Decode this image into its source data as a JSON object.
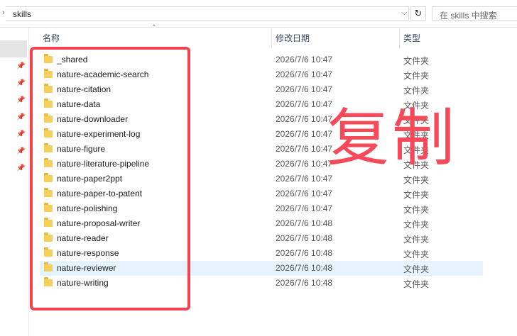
{
  "address": {
    "path": "skills",
    "dropdown_icon": "chevron-down-icon",
    "refresh_icon": "refresh-icon"
  },
  "search": {
    "placeholder": "在 skills 中搜索"
  },
  "columns": {
    "name": "名称",
    "date": "修改日期",
    "type": "类型"
  },
  "files": [
    {
      "name": "_shared",
      "date": "2026/7/6 10:47",
      "type": "文件夹"
    },
    {
      "name": "nature-academic-search",
      "date": "2026/7/6 10:47",
      "type": "文件夹"
    },
    {
      "name": "nature-citation",
      "date": "2026/7/6 10:47",
      "type": "文件夹"
    },
    {
      "name": "nature-data",
      "date": "2026/7/6 10:47",
      "type": "文件夹"
    },
    {
      "name": "nature-downloader",
      "date": "2026/7/6 10:47",
      "type": "文件夹"
    },
    {
      "name": "nature-experiment-log",
      "date": "2026/7/6 10:47",
      "type": "文件夹"
    },
    {
      "name": "nature-figure",
      "date": "2026/7/6 10:47",
      "type": "文件夹"
    },
    {
      "name": "nature-literature-pipeline",
      "date": "2026/7/6 10:47",
      "type": "文件夹"
    },
    {
      "name": "nature-paper2ppt",
      "date": "2026/7/6 10:47",
      "type": "文件夹"
    },
    {
      "name": "nature-paper-to-patent",
      "date": "2026/7/6 10:47",
      "type": "文件夹"
    },
    {
      "name": "nature-polishing",
      "date": "2026/7/6 10:47",
      "type": "文件夹"
    },
    {
      "name": "nature-proposal-writer",
      "date": "2026/7/6 10:48",
      "type": "文件夹"
    },
    {
      "name": "nature-reader",
      "date": "2026/7/6 10:48",
      "type": "文件夹"
    },
    {
      "name": "nature-response",
      "date": "2026/7/6 10:48",
      "type": "文件夹"
    },
    {
      "name": "nature-reviewer",
      "date": "2026/7/6 10:48",
      "type": "文件夹",
      "selected": true
    },
    {
      "name": "nature-writing",
      "date": "2026/7/6 10:48",
      "type": "文件夹"
    }
  ],
  "annotation": {
    "label": "复制",
    "color": "#f5404f"
  }
}
